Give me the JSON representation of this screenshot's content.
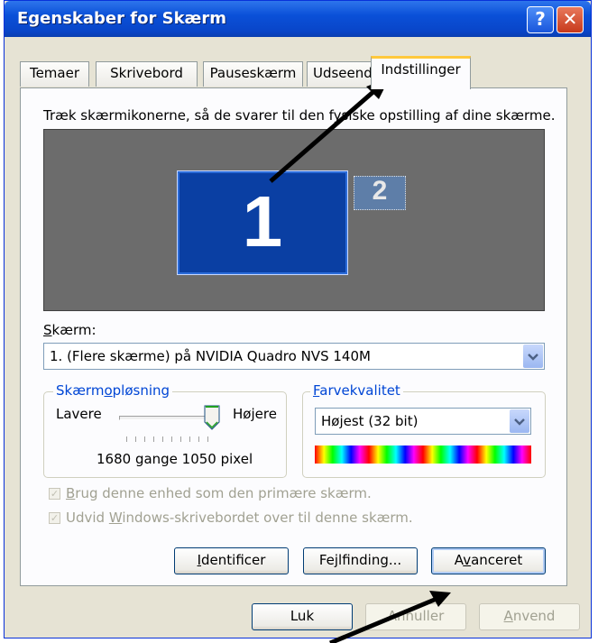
{
  "window": {
    "title": "Egenskaber for Skærm",
    "help_button": "?",
    "close_button": "✕"
  },
  "tabs": [
    {
      "label": "Temaer"
    },
    {
      "label": "Skrivebord"
    },
    {
      "label": "Pauseskærm"
    },
    {
      "label": "Udseende"
    },
    {
      "label": "Indstillinger",
      "active": true
    }
  ],
  "settings": {
    "instruction": "Træk skærmikonerne, så de svarer til den fysiske opstilling af dine skærme.",
    "monitor1_label": "1",
    "monitor2_label": "2",
    "display_label_u": "S",
    "display_label_rest": "kærm:",
    "display_value": "1. (Flere skærme) på NVIDIA Quadro NVS 140M",
    "resolution": {
      "legend_pre": "Skærm",
      "legend_u": "o",
      "legend_post": "pløsning",
      "lower": "Lavere",
      "higher": "Højere",
      "value_text": "1680 gange 1050 pixel",
      "slider_fraction": 1.0
    },
    "color_quality": {
      "legend_u": "F",
      "legend_rest": "arvekvalitet",
      "value": "Højest (32 bit)"
    },
    "checkbox_primary": {
      "u": "B",
      "rest": "rug denne enhed som den primære skærm.",
      "checked": true,
      "enabled": false
    },
    "checkbox_extend": {
      "pre": "Udvid ",
      "u": "W",
      "rest": "indows-skrivebordet over til denne skærm.",
      "checked": true,
      "enabled": false
    },
    "buttons": {
      "identify_u": "I",
      "identify_rest": "dentificer",
      "troubleshoot_pre": "Fe",
      "troubleshoot_u": "j",
      "troubleshoot_rest": "lfinding...",
      "advanced_pre": "A",
      "advanced_u": "v",
      "advanced_rest": "anceret"
    }
  },
  "dialog_buttons": {
    "ok": "Luk",
    "cancel": "Annuller",
    "apply_u": "A",
    "apply_rest": "nvend"
  },
  "colors": {
    "title_bar": "#0a50d8",
    "monitor_primary": "#0a3fa3",
    "monitor_background": "#6c6c6c",
    "active_tab_highlight": "#ffc83c",
    "annotation_arrow": "#000000"
  }
}
